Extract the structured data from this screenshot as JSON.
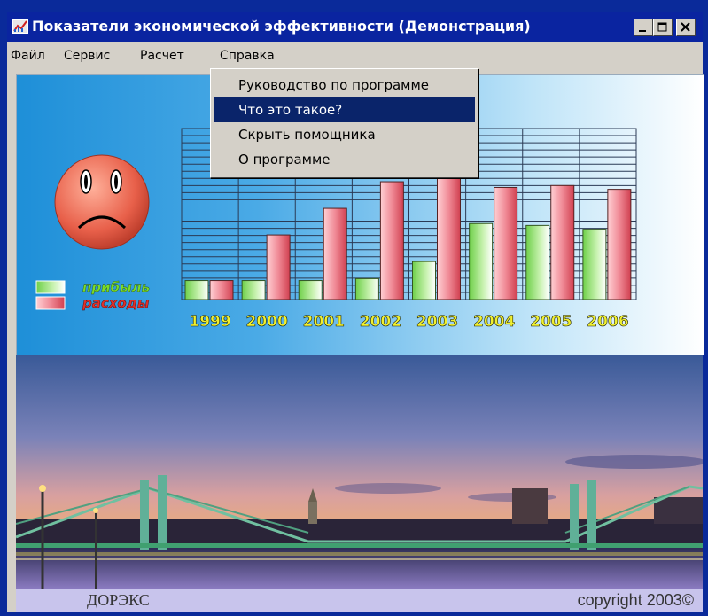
{
  "window": {
    "title": "Показатели экономической эффективности (Демонстрация)",
    "controls": {
      "minimize": "minimize-icon",
      "maximize": "maximize-icon",
      "close": "close-icon"
    }
  },
  "menu": {
    "items": [
      "Файл",
      "Сервис",
      "Расчет",
      "Справка"
    ],
    "open_menu": "Справка",
    "dropdown": [
      "Руководство по программе",
      "Что это такое?",
      "Скрыть помощника",
      "О программе"
    ],
    "selected_index": 1
  },
  "mascot": {
    "icon": "sad-face-icon",
    "color": "#e8604a"
  },
  "legend": {
    "profit": {
      "label": "прибыль",
      "color": "#9be27a",
      "text_color": "#7adc2a"
    },
    "expenses": {
      "label": "расходы",
      "color": "#f07a88",
      "text_color": "#e0302a"
    }
  },
  "chart_data": {
    "type": "bar",
    "categories": [
      "1999",
      "2000",
      "2001",
      "2002",
      "2003",
      "2004",
      "2005",
      "2006"
    ],
    "series": [
      {
        "name": "прибыль",
        "values": [
          1.0,
          1.0,
          1.0,
          1.1,
          2.0,
          4.0,
          3.9,
          3.7
        ]
      },
      {
        "name": "расходы",
        "values": [
          1.0,
          3.4,
          4.8,
          6.2,
          7.2,
          5.9,
          6.0,
          5.8
        ]
      }
    ],
    "ylim": [
      0,
      9
    ],
    "grid": true
  },
  "photo": {
    "description_icon": "night-bridge-photo"
  },
  "footer": {
    "left": "ДОРЭКС",
    "right": "copyright 2003©"
  }
}
